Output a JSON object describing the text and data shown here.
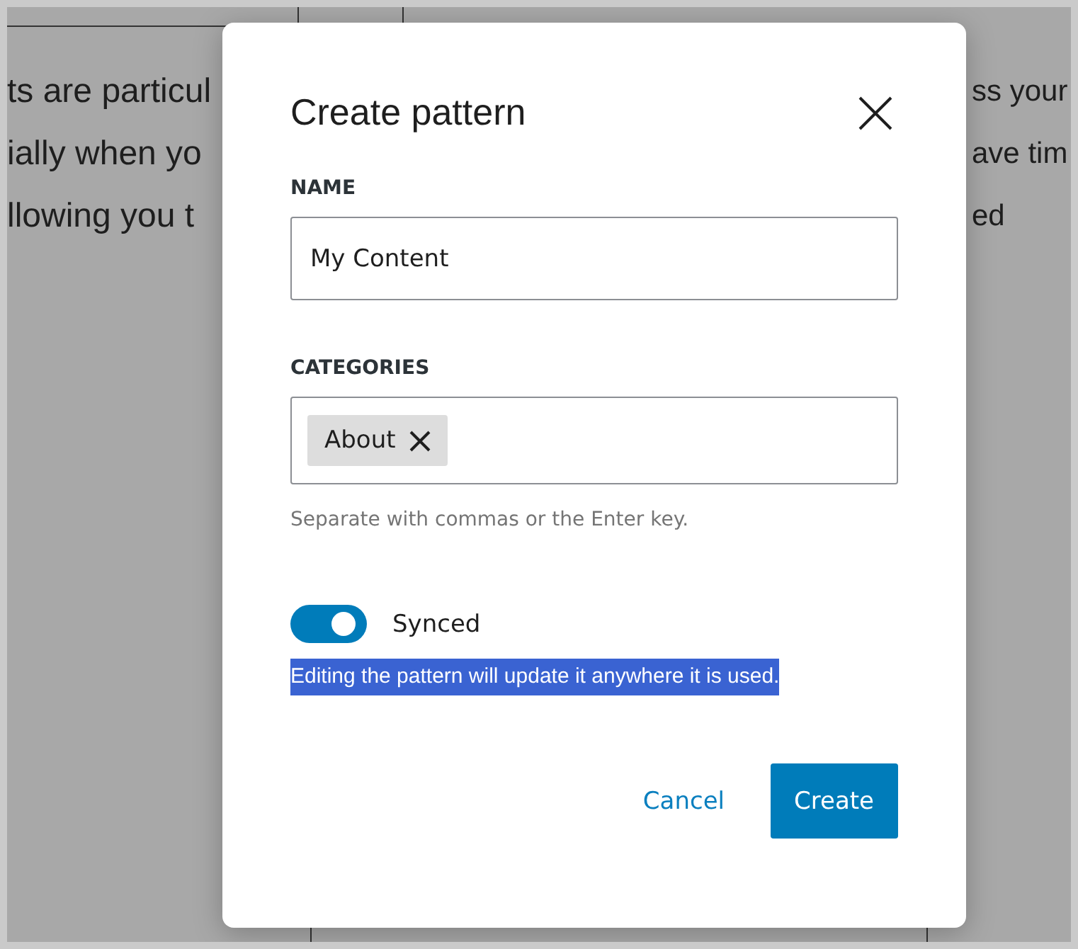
{
  "background": {
    "left_lines": [
      "ts are particul",
      "ially when yo",
      "llowing you t"
    ],
    "right_lines": [
      "ss your",
      "ave tim",
      "ed"
    ]
  },
  "dialog": {
    "title": "Create pattern",
    "name_field": {
      "label": "NAME",
      "value": "My Content"
    },
    "categories_field": {
      "label": "CATEGORIES",
      "tokens": [
        {
          "label": "About"
        }
      ],
      "help": "Separate with commas or the Enter key."
    },
    "synced_toggle": {
      "label": "Synced",
      "on": true
    },
    "description": {
      "text": "Editing the pattern will update it anywhere it is used.",
      "highlighted": true
    },
    "buttons": [
      {
        "label": "Cancel",
        "kind": "link"
      },
      {
        "label": "Create",
        "kind": "primary"
      }
    ]
  }
}
